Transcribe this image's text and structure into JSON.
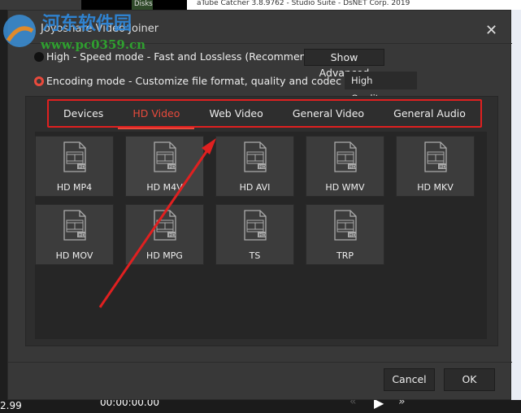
{
  "background": {
    "window_title": "aTube Catcher 3.8.9762 - Studio Suite - DsNET Corp. 2019",
    "taskbar_text": "Disks",
    "left_value": "2.99",
    "timecode": "00:00:00.00"
  },
  "watermark": {
    "text": "河东软件园",
    "url": "www.pc0359.cn"
  },
  "dialog": {
    "title": "Joyoshare Video Joiner",
    "close_label": "✕",
    "mode_high": "High - Speed mode - Fast and Lossless (Recommended)",
    "show_advanced": "Show Advanced",
    "mode_encoding": "Encoding mode - Customize file format, quality and codec (Slow)",
    "quality": "High Quality",
    "tabs": [
      {
        "label": "Devices"
      },
      {
        "label": "HD Video",
        "active": true
      },
      {
        "label": "Web Video"
      },
      {
        "label": "General Video"
      },
      {
        "label": "General Audio"
      }
    ],
    "formats": [
      {
        "label": "HD MP4"
      },
      {
        "label": "HD M4V"
      },
      {
        "label": "HD AVI"
      },
      {
        "label": "HD WMV"
      },
      {
        "label": "HD MKV"
      },
      {
        "label": "HD MOV"
      },
      {
        "label": "HD MPG"
      },
      {
        "label": "TS"
      },
      {
        "label": "TRP"
      }
    ],
    "cancel": "Cancel",
    "ok": "OK"
  },
  "colors": {
    "accent": "#e84a3c",
    "annotation": "#e02020"
  }
}
